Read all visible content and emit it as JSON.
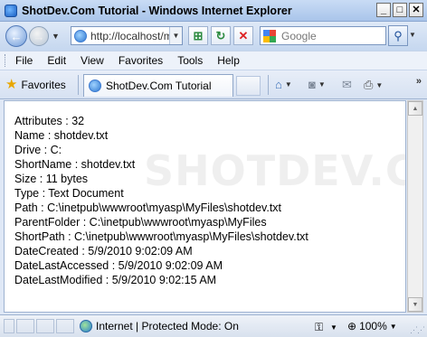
{
  "window": {
    "title": "ShotDev.Com Tutorial - Windows Internet Explorer",
    "min": "_",
    "max": "□",
    "close": "✕"
  },
  "nav": {
    "back_icon": "←",
    "forward_icon": "→",
    "address": "http://localhost/m",
    "search_placeholder": "Google",
    "search_go_icon": "⚲"
  },
  "menu": {
    "items": [
      "File",
      "Edit",
      "View",
      "Favorites",
      "Tools",
      "Help"
    ]
  },
  "favbar": {
    "favorites_label": "Favorites",
    "tab_label": "ShotDev.Com Tutorial"
  },
  "content": {
    "watermark": "SHOTDEV.COM",
    "lines": [
      "Attributes : 32",
      "Name : shotdev.txt",
      "Drive : C:",
      "ShortName : shotdev.txt",
      "Size : 11 bytes",
      "Type : Text Document",
      "Path : C:\\inetpub\\wwwroot\\myasp\\MyFiles\\shotdev.txt",
      "ParentFolder : C:\\inetpub\\wwwroot\\myasp\\MyFiles",
      "ShortPath : C:\\inetpub\\wwwroot\\myasp\\MyFiles\\shotdev.txt",
      "DateCreated : 5/9/2010 9:02:09 AM",
      "DateLastAccessed : 5/9/2010 9:02:09 AM",
      "DateLastModified : 5/9/2010 9:02:15 AM"
    ]
  },
  "status": {
    "zone": "Internet | Protected Mode: On",
    "zoom": "100%"
  },
  "icons": [
    "ie-icon",
    "back-icon",
    "forward-icon",
    "compat-icon",
    "refresh-icon",
    "stop-icon",
    "search-icon",
    "star-icon",
    "home-icon",
    "feeds-icon",
    "mail-icon",
    "print-icon",
    "globe-icon",
    "security-icon",
    "zoom-icon"
  ]
}
